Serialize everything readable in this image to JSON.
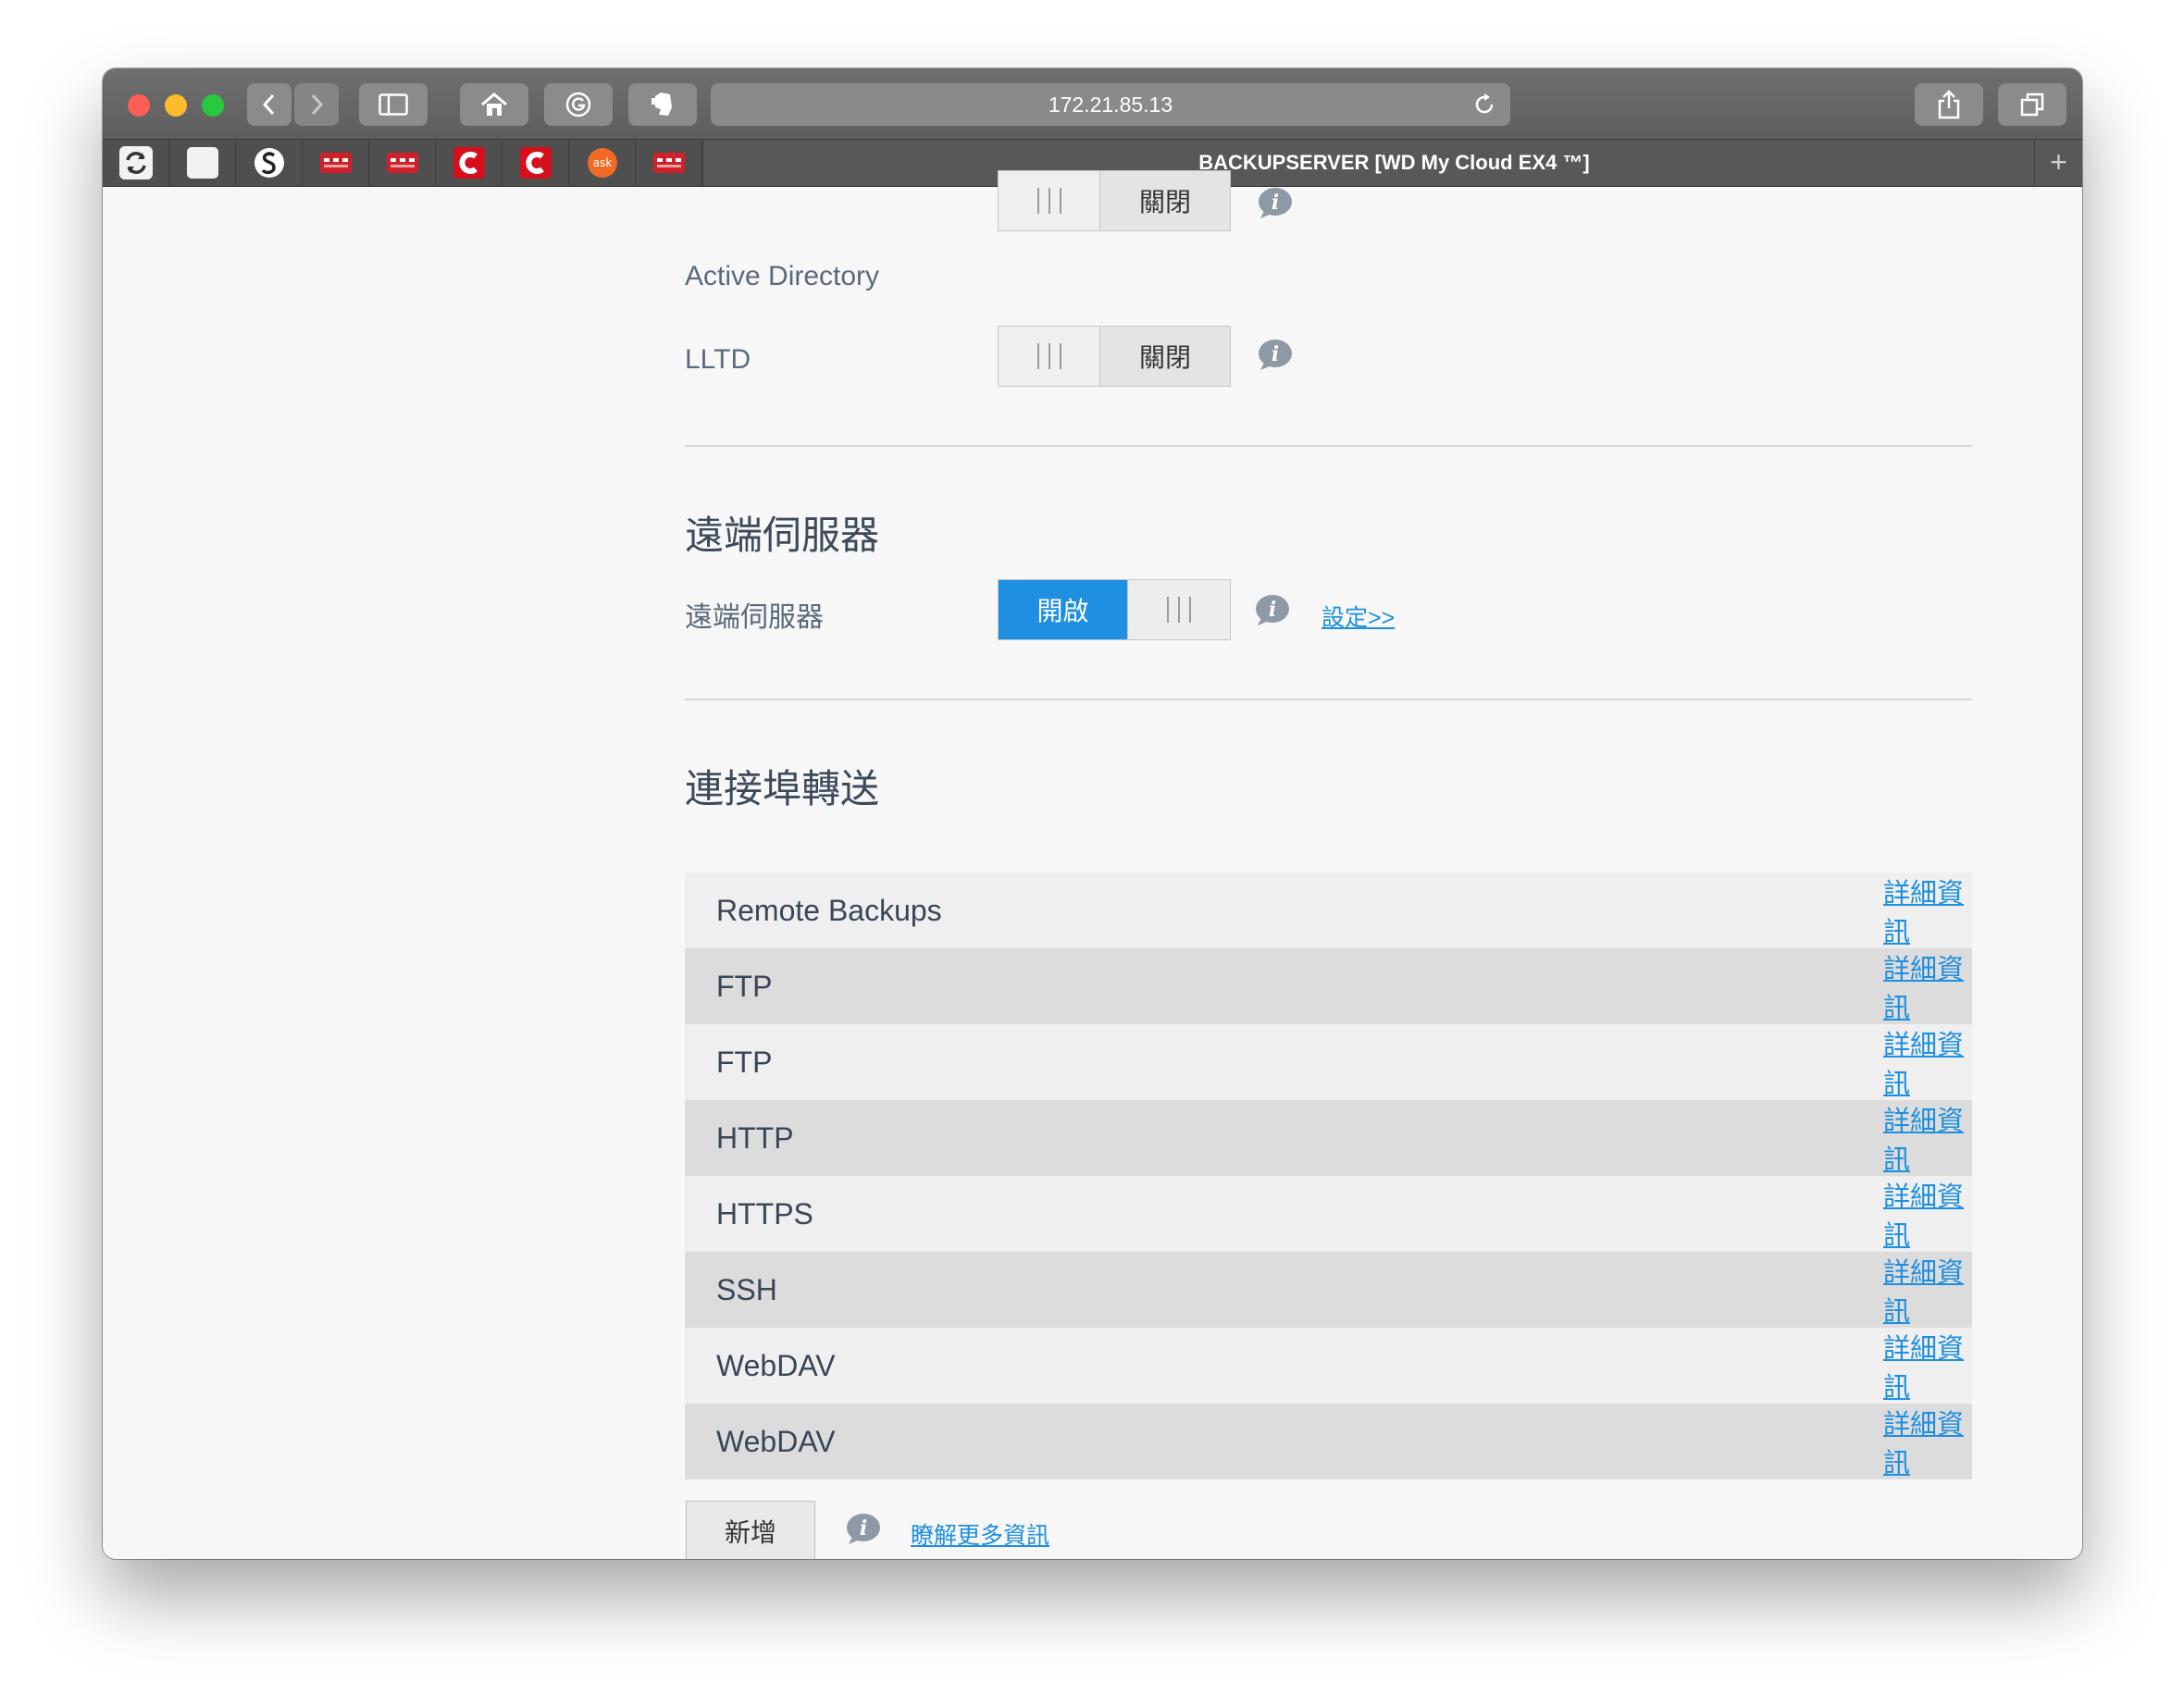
{
  "browser": {
    "url": "172.21.85.13",
    "tab_title": "BACKUPSERVER [WD My Cloud EX4 ™]",
    "tab_plus": "+",
    "favicons": [
      "sync-icon",
      "blank-page-icon",
      "scribd-icon",
      "lastpass-red-icon",
      "lastpass-red-icon",
      "c-red-icon",
      "c-red-icon",
      "ask-icon",
      "lastpass-red-icon"
    ],
    "ask_label": "ask"
  },
  "network_services": [
    {
      "label": "Active Directory",
      "state": "關閉"
    },
    {
      "label": "LLTD",
      "state": "關閉"
    }
  ],
  "remote_server": {
    "section_title": "遠端伺服器",
    "label": "遠端伺服器",
    "state": "開啟",
    "settings_link": "設定>>"
  },
  "port_forwarding": {
    "section_title": "連接埠轉送",
    "rows": [
      {
        "name": "Remote Backups",
        "link": "詳細資訊"
      },
      {
        "name": "FTP",
        "link": "詳細資訊"
      },
      {
        "name": "FTP",
        "link": "詳細資訊"
      },
      {
        "name": "HTTP",
        "link": "詳細資訊"
      },
      {
        "name": "HTTPS",
        "link": "詳細資訊"
      },
      {
        "name": "SSH",
        "link": "詳細資訊"
      },
      {
        "name": "WebDAV",
        "link": "詳細資訊"
      },
      {
        "name": "WebDAV",
        "link": "詳細資訊"
      }
    ],
    "add_button": "新增",
    "learn_more": "瞭解更多資訊"
  },
  "colors": {
    "accent": "#1e8fe1",
    "link": "#1d8fe0",
    "row_light": "#efefef",
    "row_dark": "#dcdcdc"
  }
}
